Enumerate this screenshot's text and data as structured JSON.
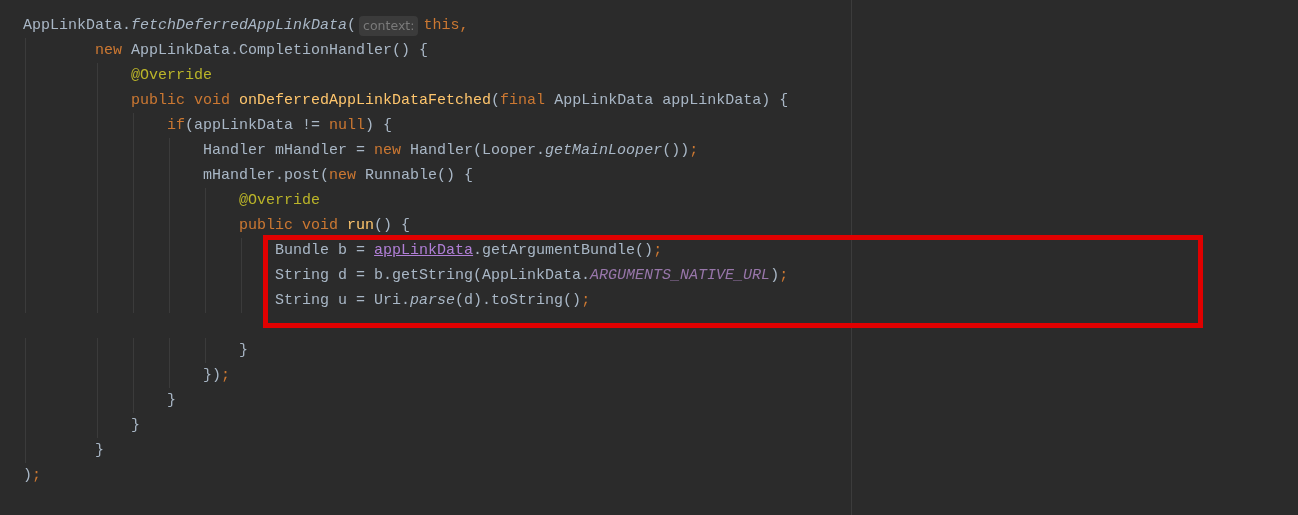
{
  "editor": {
    "blocks": [
      {
        "highlighted": false,
        "lines": [
          {
            "segments": [
              {
                "kind": "code",
                "tokens": [
                  {
                    "kind": "plain",
                    "text": "AppLinkData."
                  },
                  {
                    "kind": "static",
                    "text": "fetchDeferredAppLinkData"
                  },
                  {
                    "kind": "plain",
                    "text": "("
                  }
                ]
              },
              {
                "kind": "hint",
                "text": "context:"
              },
              {
                "kind": "code",
                "tokens": [
                  {
                    "kind": "keyword",
                    "text": "this,"
                  }
                ]
              }
            ]
          },
          {
            "segments": [
              {
                "kind": "code",
                "tokens": [
                  {
                    "kind": "keyword",
                    "text": "        new"
                  },
                  {
                    "kind": "plain",
                    "text": " AppLinkData.CompletionHandler() {"
                  }
                ]
              }
            ]
          },
          {
            "segments": [
              {
                "kind": "code",
                "tokens": [
                  {
                    "kind": "annotation",
                    "text": "            @Override"
                  }
                ]
              }
            ]
          },
          {
            "segments": [
              {
                "kind": "code",
                "tokens": [
                  {
                    "kind": "keyword",
                    "text": "            public void "
                  },
                  {
                    "kind": "decl",
                    "text": "onDeferredAppLinkDataFetched"
                  },
                  {
                    "kind": "plain",
                    "text": "("
                  },
                  {
                    "kind": "keyword",
                    "text": "final"
                  },
                  {
                    "kind": "plain",
                    "text": " AppLinkData appLinkData) {"
                  }
                ]
              }
            ]
          },
          {
            "segments": [
              {
                "kind": "code",
                "tokens": [
                  {
                    "kind": "keyword",
                    "text": "                if"
                  },
                  {
                    "kind": "plain",
                    "text": "(appLinkData != "
                  },
                  {
                    "kind": "keyword",
                    "text": "null"
                  },
                  {
                    "kind": "plain",
                    "text": ") {"
                  }
                ]
              }
            ]
          },
          {
            "segments": [
              {
                "kind": "code",
                "tokens": [
                  {
                    "kind": "plain",
                    "text": "                    Handler mHandler = "
                  },
                  {
                    "kind": "keyword",
                    "text": "new"
                  },
                  {
                    "kind": "plain",
                    "text": " Handler(Looper."
                  },
                  {
                    "kind": "static",
                    "text": "getMainLooper"
                  },
                  {
                    "kind": "plain",
                    "text": "())"
                  },
                  {
                    "kind": "keyword",
                    "text": ";"
                  }
                ]
              }
            ]
          },
          {
            "segments": [
              {
                "kind": "code",
                "tokens": [
                  {
                    "kind": "plain",
                    "text": "                    mHandler.post("
                  },
                  {
                    "kind": "keyword",
                    "text": "new"
                  },
                  {
                    "kind": "plain",
                    "text": " Runnable() {"
                  }
                ]
              }
            ]
          },
          {
            "segments": [
              {
                "kind": "code",
                "tokens": [
                  {
                    "kind": "annotation",
                    "text": "                        @Override"
                  }
                ]
              }
            ]
          },
          {
            "segments": [
              {
                "kind": "code",
                "tokens": [
                  {
                    "kind": "keyword",
                    "text": "                        public void "
                  },
                  {
                    "kind": "decl",
                    "text": "run"
                  },
                  {
                    "kind": "plain",
                    "text": "() {"
                  }
                ]
              }
            ]
          }
        ]
      },
      {
        "highlighted": true,
        "lines": [
          {
            "segments": [
              {
                "kind": "code",
                "tokens": [
                  {
                    "kind": "plain",
                    "text": "                            Bundle b = "
                  },
                  {
                    "kind": "captured",
                    "text": "appLinkData"
                  },
                  {
                    "kind": "plain",
                    "text": ".getArgumentBundle()"
                  },
                  {
                    "kind": "keyword",
                    "text": ";"
                  }
                ]
              }
            ]
          },
          {
            "segments": [
              {
                "kind": "code",
                "tokens": [
                  {
                    "kind": "plain",
                    "text": "                            String d = b.getString(AppLinkData."
                  },
                  {
                    "kind": "constant",
                    "text": "ARGUMENTS_NATIVE_URL"
                  },
                  {
                    "kind": "plain",
                    "text": ")"
                  },
                  {
                    "kind": "keyword",
                    "text": ";"
                  }
                ]
              }
            ]
          },
          {
            "segments": [
              {
                "kind": "code",
                "tokens": [
                  {
                    "kind": "plain",
                    "text": "                            String u = Uri."
                  },
                  {
                    "kind": "static",
                    "text": "parse"
                  },
                  {
                    "kind": "plain",
                    "text": "(d).toString()"
                  },
                  {
                    "kind": "keyword",
                    "text": ";"
                  }
                ]
              }
            ]
          }
        ]
      },
      {
        "highlighted": false,
        "lines": [
          {
            "segments": [
              {
                "kind": "code",
                "tokens": [
                  {
                    "kind": "plain",
                    "text": "                        }"
                  }
                ]
              }
            ]
          },
          {
            "segments": [
              {
                "kind": "code",
                "tokens": [
                  {
                    "kind": "plain",
                    "text": "                    })"
                  },
                  {
                    "kind": "keyword",
                    "text": ";"
                  }
                ]
              }
            ]
          },
          {
            "segments": [
              {
                "kind": "code",
                "tokens": [
                  {
                    "kind": "plain",
                    "text": "                }"
                  }
                ]
              }
            ]
          },
          {
            "segments": [
              {
                "kind": "code",
                "tokens": [
                  {
                    "kind": "plain",
                    "text": "            }"
                  }
                ]
              }
            ]
          },
          {
            "segments": [
              {
                "kind": "code",
                "tokens": [
                  {
                    "kind": "plain",
                    "text": "        }"
                  }
                ]
              }
            ]
          },
          {
            "segments": [
              {
                "kind": "code",
                "tokens": [
                  {
                    "kind": "plain",
                    "text": ")"
                  },
                  {
                    "kind": "keyword",
                    "text": ";"
                  }
                ]
              }
            ]
          }
        ]
      }
    ]
  }
}
